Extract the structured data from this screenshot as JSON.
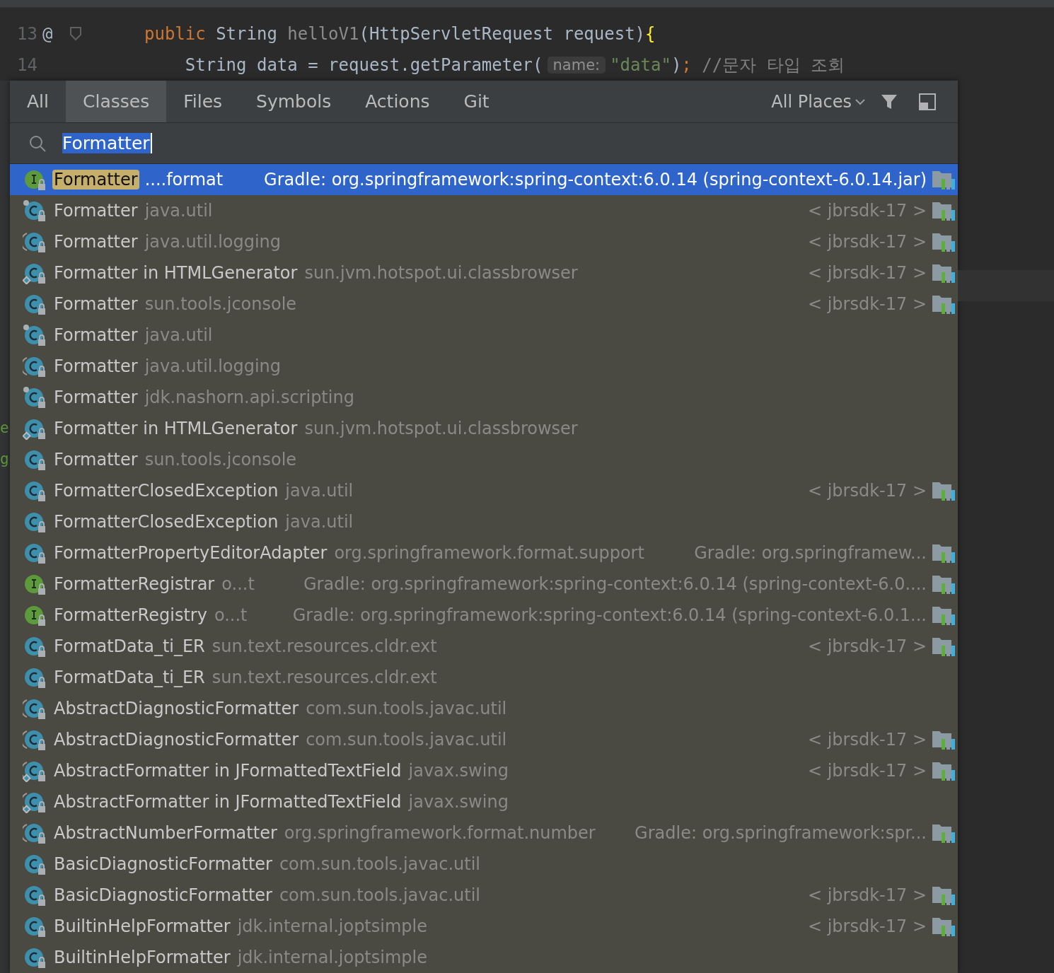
{
  "editor": {
    "lines": [
      {
        "number": "13",
        "gutter": "@",
        "tokens": [
          {
            "kind": "keyword",
            "text": "public "
          },
          {
            "kind": "plain",
            "text": "String "
          },
          {
            "kind": "unused",
            "text": "helloV1"
          },
          {
            "kind": "plain",
            "text": "(HttpServletRequest request)"
          },
          {
            "kind": "brace",
            "text": "{"
          }
        ]
      },
      {
        "number": "14",
        "tokens": [
          {
            "kind": "plain",
            "text": "    String data = request.getParameter("
          },
          {
            "kind": "hint",
            "text": "name:"
          },
          {
            "kind": "string",
            "text": "\"data\""
          },
          {
            "kind": "plain",
            "text": ")"
          },
          {
            "kind": "keyword",
            "text": "; "
          },
          {
            "kind": "comment",
            "text": "//문자 타입 조회"
          }
        ]
      }
    ]
  },
  "search_everywhere": {
    "tabs": [
      {
        "label": "All",
        "selected": false
      },
      {
        "label": "Classes",
        "selected": true
      },
      {
        "label": "Files",
        "selected": false
      },
      {
        "label": "Symbols",
        "selected": false
      },
      {
        "label": "Actions",
        "selected": false
      },
      {
        "label": "Git",
        "selected": false
      }
    ],
    "scope": "All Places",
    "search": {
      "value": "Formatter"
    },
    "results": [
      {
        "kind": "interface",
        "name": "Formatter",
        "package": "....format",
        "location": "Gradle: org.springframework:spring-context:6.0.14 (spring-context-6.0.14.jar)",
        "library": true,
        "selected": true
      },
      {
        "kind": "pinned",
        "name": "Formatter",
        "package": "java.util",
        "location": "< jbrsdk-17 >",
        "library": true,
        "selected": false
      },
      {
        "kind": "abstract",
        "name": "Formatter",
        "package": "java.util.logging",
        "location": "< jbrsdk-17 >",
        "library": true,
        "selected": false
      },
      {
        "kind": "inner",
        "name": "Formatter in HTMLGenerator",
        "package": "sun.jvm.hotspot.ui.classbrowser",
        "location": "< jbrsdk-17 >",
        "library": true,
        "selected": false
      },
      {
        "kind": "class",
        "name": "Formatter",
        "package": "sun.tools.jconsole",
        "location": "< jbrsdk-17 >",
        "library": true,
        "selected": false
      },
      {
        "kind": "pinned",
        "name": "Formatter",
        "package": "java.util",
        "library": false,
        "selected": false
      },
      {
        "kind": "abstract",
        "name": "Formatter",
        "package": "java.util.logging",
        "library": false,
        "selected": false
      },
      {
        "kind": "pinned",
        "name": "Formatter",
        "package": "jdk.nashorn.api.scripting",
        "library": false,
        "selected": false
      },
      {
        "kind": "inner",
        "name": "Formatter in HTMLGenerator",
        "package": "sun.jvm.hotspot.ui.classbrowser",
        "library": false,
        "selected": false,
        "behind": "e"
      },
      {
        "kind": "class",
        "name": "Formatter",
        "package": "sun.tools.jconsole",
        "library": false,
        "selected": false,
        "behind": "g"
      },
      {
        "kind": "class",
        "name": "FormatterClosedException",
        "package": "java.util",
        "location": "< jbrsdk-17 >",
        "library": true,
        "selected": false
      },
      {
        "kind": "class",
        "name": "FormatterClosedException",
        "package": "java.util",
        "library": false,
        "selected": false
      },
      {
        "kind": "class",
        "name": "FormatterPropertyEditorAdapter",
        "package": "org.springframework.format.support",
        "location": "Gradle: org.springframew...",
        "library": true,
        "selected": false
      },
      {
        "kind": "interface",
        "name": "FormatterRegistrar",
        "package": "o...t",
        "location": "Gradle: org.springframework:spring-context:6.0.14 (spring-context-6.0....",
        "library": true,
        "selected": false
      },
      {
        "kind": "interface",
        "name": "FormatterRegistry",
        "package": "o...t",
        "location": "Gradle: org.springframework:spring-context:6.0.14 (spring-context-6.0.1...",
        "library": true,
        "selected": false
      },
      {
        "kind": "class",
        "name": "FormatData_ti_ER",
        "package": "sun.text.resources.cldr.ext",
        "location": "< jbrsdk-17 >",
        "library": true,
        "selected": false
      },
      {
        "kind": "class",
        "name": "FormatData_ti_ER",
        "package": "sun.text.resources.cldr.ext",
        "library": false,
        "selected": false
      },
      {
        "kind": "abstract",
        "name": "AbstractDiagnosticFormatter",
        "package": "com.sun.tools.javac.util",
        "library": false,
        "selected": false
      },
      {
        "kind": "abstract",
        "name": "AbstractDiagnosticFormatter",
        "package": "com.sun.tools.javac.util",
        "location": "< jbrsdk-17 >",
        "library": true,
        "selected": false
      },
      {
        "kind": "abstractinner",
        "name": "AbstractFormatter in JFormattedTextField",
        "package": "javax.swing",
        "location": "< jbrsdk-17 >",
        "library": true,
        "selected": false
      },
      {
        "kind": "abstractinner",
        "name": "AbstractFormatter in JFormattedTextField",
        "package": "javax.swing",
        "library": false,
        "selected": false
      },
      {
        "kind": "abstract",
        "name": "AbstractNumberFormatter",
        "package": "org.springframework.format.number",
        "location": "Gradle: org.springframework:spr...",
        "library": true,
        "selected": false
      },
      {
        "kind": "class",
        "name": "BasicDiagnosticFormatter",
        "package": "com.sun.tools.javac.util",
        "library": false,
        "selected": false
      },
      {
        "kind": "class",
        "name": "BasicDiagnosticFormatter",
        "package": "com.sun.tools.javac.util",
        "location": "< jbrsdk-17 >",
        "library": true,
        "selected": false
      },
      {
        "kind": "class",
        "name": "BuiltinHelpFormatter",
        "package": "jdk.internal.joptsimple",
        "location": "< jbrsdk-17 >",
        "library": true,
        "selected": false
      },
      {
        "kind": "class",
        "name": "BuiltinHelpFormatter",
        "package": "jdk.internal.joptsimple",
        "library": false,
        "selected": false
      }
    ]
  }
}
